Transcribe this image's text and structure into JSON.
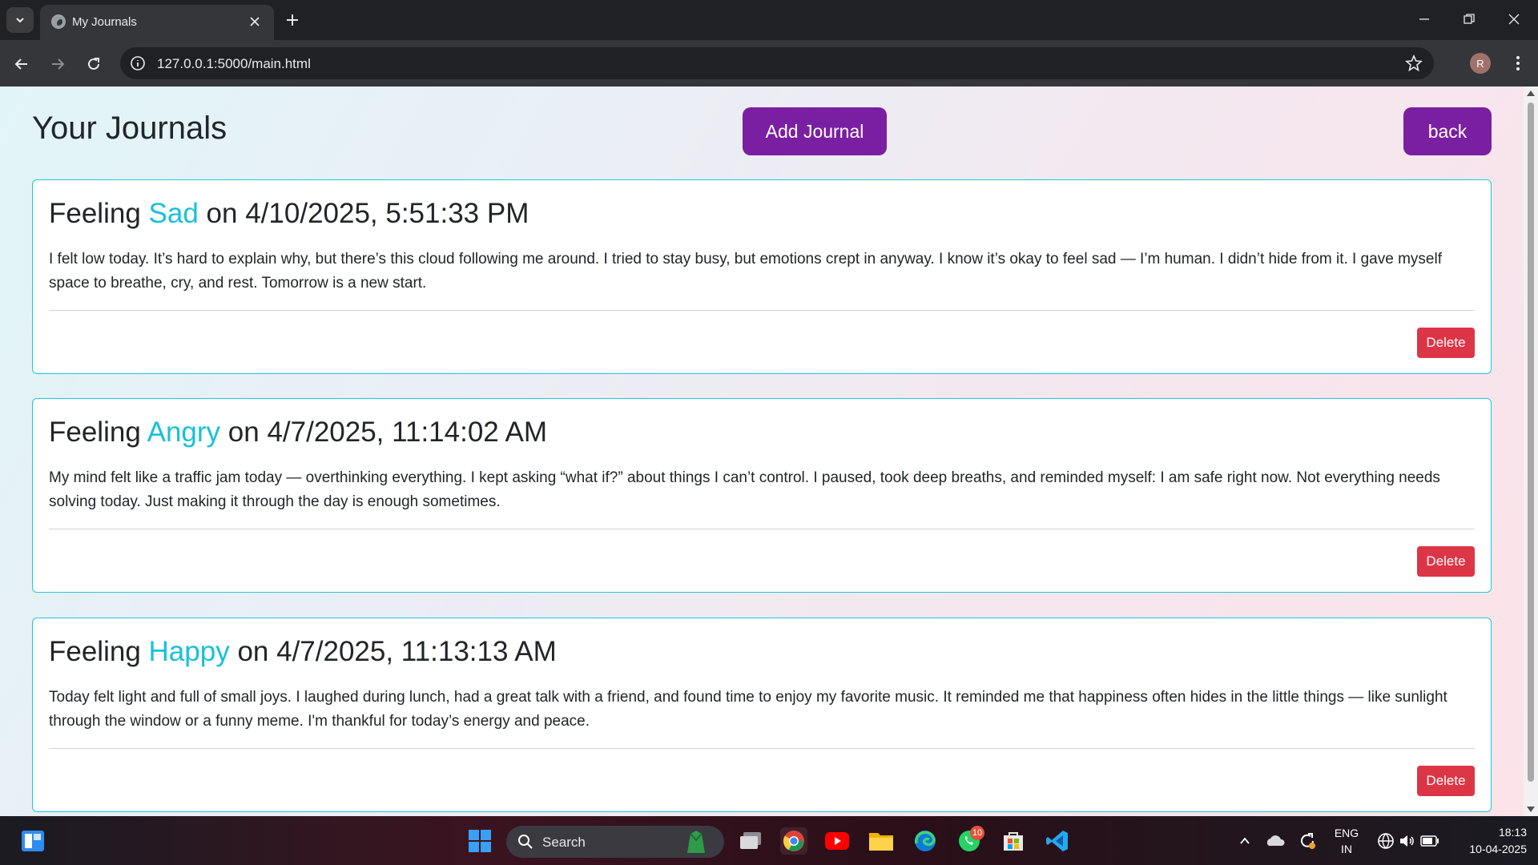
{
  "browser": {
    "tab_title": "My Journals",
    "url": "127.0.0.1:5000/main.html",
    "profile_initial": "R"
  },
  "page": {
    "title": "Your Journals",
    "add_button": "Add Journal",
    "back_button": "back",
    "entries": [
      {
        "prefix": "Feeling",
        "mood": "Sad",
        "middle": "on",
        "datetime": "4/10/2025, 5:51:33 PM",
        "text": "I felt low today. It’s hard to explain why, but there’s this cloud following me around. I tried to stay busy, but emotions crept in anyway. I know it’s okay to feel sad — I’m human. I didn’t hide from it. I gave myself space to breathe, cry, and rest. Tomorrow is a new start.",
        "delete_label": "Delete"
      },
      {
        "prefix": "Feeling",
        "mood": "Angry",
        "middle": "on",
        "datetime": "4/7/2025, 11:14:02 AM",
        "text": "My mind felt like a traffic jam today — overthinking everything. I kept asking “what if?” about things I can’t control. I paused, took deep breaths, and reminded myself: I am safe right now. Not everything needs solving today. Just making it through the day is enough sometimes.",
        "delete_label": "Delete"
      },
      {
        "prefix": "Feeling",
        "mood": "Happy",
        "middle": "on",
        "datetime": "4/7/2025, 11:13:13 AM",
        "text": "Today felt light and full of small joys. I laughed during lunch, had a great talk with a friend, and found time to enjoy my favorite music. It reminded me that happiness often hides in the little things — like sunlight through the window or a funny meme. I'm thankful for today’s energy and peace.",
        "delete_label": "Delete"
      }
    ]
  },
  "colors": {
    "accent_purple": "#7b1fa2",
    "mood_cyan": "#17c1d8",
    "delete_red": "#dc3545",
    "card_border": "#1fc8db"
  },
  "taskbar": {
    "search_label": "Search",
    "whatsapp_badge": "10",
    "lang_top": "ENG",
    "lang_bottom": "IN",
    "time": "18:13",
    "date": "10-04-2025"
  }
}
